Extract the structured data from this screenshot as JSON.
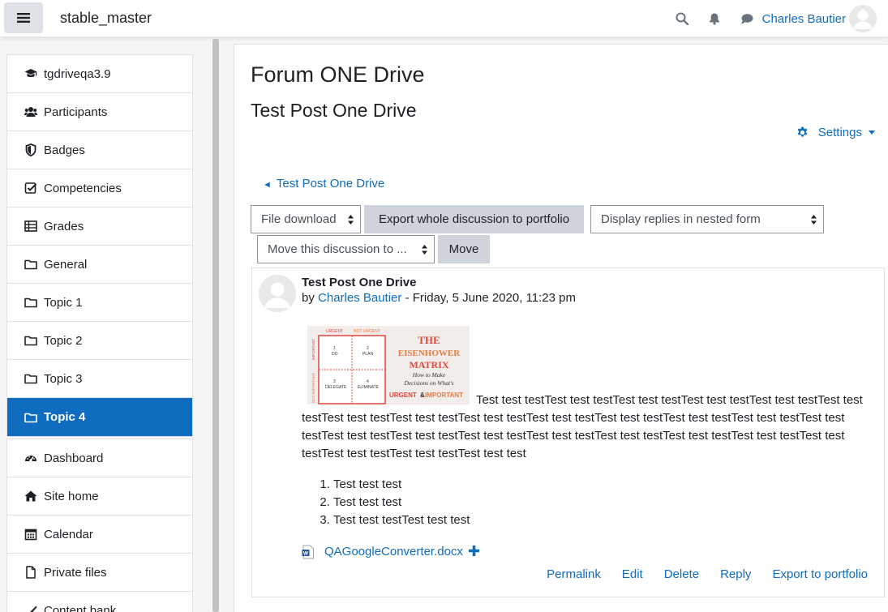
{
  "navbar": {
    "site_name": "stable_master",
    "user_name": "Charles Bautier"
  },
  "drawer": {
    "course_items": [
      {
        "label": "tgdriveqa3.9",
        "icon": "graduation-cap-icon"
      },
      {
        "label": "Participants",
        "icon": "users-icon"
      },
      {
        "label": "Badges",
        "icon": "shield-icon"
      },
      {
        "label": "Competencies",
        "icon": "checkbox-icon"
      },
      {
        "label": "Grades",
        "icon": "table-icon"
      },
      {
        "label": "General",
        "icon": "folder-icon"
      },
      {
        "label": "Topic 1",
        "icon": "folder-icon"
      },
      {
        "label": "Topic 2",
        "icon": "folder-icon"
      },
      {
        "label": "Topic 3",
        "icon": "folder-icon"
      },
      {
        "label": "Topic 4",
        "icon": "folder-icon",
        "active": true
      }
    ],
    "site_items": [
      {
        "label": "Dashboard",
        "icon": "dashboard-icon"
      },
      {
        "label": "Site home",
        "icon": "home-icon"
      },
      {
        "label": "Calendar",
        "icon": "calendar-icon"
      },
      {
        "label": "Private files",
        "icon": "file-icon"
      },
      {
        "label": "Content bank",
        "icon": "brush-icon"
      }
    ]
  },
  "main": {
    "forum_title": "Forum ONE Drive",
    "discussion_title": "Test Post One Drive",
    "settings_label": "Settings",
    "back_link": "Test Post One Drive",
    "back_arrow": "◄",
    "file_download": "File download",
    "export_discussion": "Export whole discussion to portfolio",
    "display_mode": "Display replies in nested form",
    "move_select": "Move this discussion to ...",
    "move_button": "Move"
  },
  "post": {
    "title": "Test Post One Drive",
    "by": "by",
    "author": "Charles Bautier",
    "date": " - Friday, 5 June 2020, 11:23 pm",
    "body": "Test test testTest test testTest test testTest test testTest test testTest test testTest test testTest test testTest test testTest test testTest test testTest test testTest test testTest test testTest test testTest test testTest test testTest test testTest test testTest test testTest test testTest test testTest test testTest test testTest test test",
    "list": [
      "Test test test",
      "Test test test",
      "Test test testTest test test"
    ],
    "attachment": "QAGoogleConverter.docx",
    "attachment_plus": "✚",
    "actions": [
      "Permalink",
      "Edit",
      "Delete",
      "Reply",
      "Export to portfolio"
    ],
    "image": {
      "urgent": "URGENT",
      "not_urgent": "NOT URGENT",
      "important": "IMPORTANT",
      "not_important": "NOT IMPORTANT",
      "q1": "DO",
      "q2": "PLAN",
      "q3": "DELEGATE",
      "q4": "ELIMINATE",
      "n1": "1",
      "n2": "2",
      "n3": "3",
      "n4": "4",
      "the": "THE",
      "eisenhower": "EISENHOWER",
      "matrix": "MATRIX",
      "sub1": "How to Make",
      "sub2": "Decisions on What's",
      "sub3a": "URGENT",
      "sub3b": "&",
      "sub3c": "IMPORTANT"
    }
  },
  "colors": {
    "brand": "#0f6cbf",
    "active_bg": "#0f6cbf",
    "button_grey": "#ced4da",
    "image_red": "#e0473c",
    "image_orange": "#e87d3e"
  }
}
